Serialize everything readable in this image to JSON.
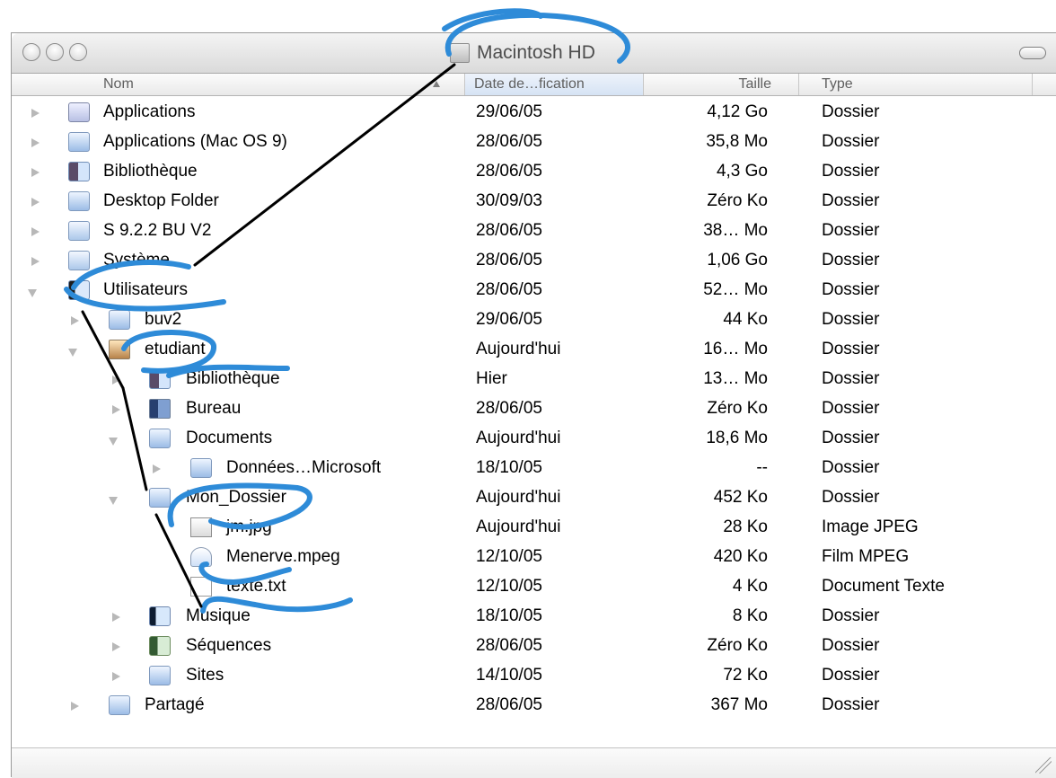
{
  "window": {
    "title": "Macintosh HD",
    "colors": {
      "annotation_blue": "#2e8bd8",
      "annotation_black": "#000000"
    }
  },
  "columns": {
    "name": "Nom",
    "date": "Date de…fication",
    "size": "Taille",
    "type": "Type"
  },
  "rows": [
    {
      "name": "Applications",
      "date": "29/06/05",
      "size": "4,12 Go",
      "type": "Dossier",
      "icon": "applications-folder-icon",
      "disclosure": "collapsed"
    },
    {
      "name": "Applications (Mac OS 9)",
      "date": "28/06/05",
      "size": "35,8 Mo",
      "type": "Dossier",
      "icon": "folder-icon",
      "disclosure": "collapsed"
    },
    {
      "name": "Bibliothèque",
      "date": "28/06/05",
      "size": "4,3 Go",
      "type": "Dossier",
      "icon": "library-folder-icon",
      "disclosure": "collapsed"
    },
    {
      "name": "Desktop Folder",
      "date": "30/09/03",
      "size": "Zéro Ko",
      "type": "Dossier",
      "icon": "folder-icon",
      "disclosure": "collapsed"
    },
    {
      "name": "S 9.2.2 BU V2",
      "date": "28/06/05",
      "size": "38… Mo",
      "type": "Dossier",
      "icon": "system-folder-icon",
      "disclosure": "collapsed"
    },
    {
      "name": "Système",
      "date": "28/06/05",
      "size": "1,06 Go",
      "type": "Dossier",
      "icon": "system-folder-icon",
      "disclosure": "collapsed"
    },
    {
      "name": "Utilisateurs",
      "date": "28/06/05",
      "size": "52… Mo",
      "type": "Dossier",
      "icon": "users-folder-icon",
      "disclosure": "expanded"
    },
    {
      "name": "buv2",
      "date": "29/06/05",
      "size": "44 Ko",
      "type": "Dossier",
      "icon": "folder-icon",
      "disclosure": "collapsed"
    },
    {
      "name": "etudiant",
      "date": "Aujourd'hui",
      "size": "16… Mo",
      "type": "Dossier",
      "icon": "home-folder-icon",
      "disclosure": "expanded"
    },
    {
      "name": "Bibliothèque",
      "date": "Hier",
      "size": "13… Mo",
      "type": "Dossier",
      "icon": "library-folder-icon",
      "disclosure": "collapsed"
    },
    {
      "name": "Bureau",
      "date": "28/06/05",
      "size": "Zéro Ko",
      "type": "Dossier",
      "icon": "desktop-folder-icon",
      "disclosure": "collapsed"
    },
    {
      "name": "Documents",
      "date": "Aujourd'hui",
      "size": "18,6 Mo",
      "type": "Dossier",
      "icon": "documents-folder-icon",
      "disclosure": "expanded"
    },
    {
      "name": "Données…Microsoft",
      "date": "18/10/05",
      "size": "--",
      "type": "Dossier",
      "icon": "folder-icon",
      "disclosure": "collapsed"
    },
    {
      "name": "Mon_Dossier",
      "date": "Aujourd'hui",
      "size": "452 Ko",
      "type": "Dossier",
      "icon": "folder-icon",
      "disclosure": "expanded"
    },
    {
      "name": "jm.jpg",
      "date": "Aujourd'hui",
      "size": "28 Ko",
      "type": "Image JPEG",
      "icon": "jpeg-file-icon",
      "disclosure": "none"
    },
    {
      "name": "Menerve.mpeg",
      "date": "12/10/05",
      "size": "420 Ko",
      "type": "Film MPEG",
      "icon": "mpeg-file-icon",
      "disclosure": "none"
    },
    {
      "name": "texte.txt",
      "date": "12/10/05",
      "size": "4 Ko",
      "type": "Document Texte",
      "icon": "text-file-icon",
      "disclosure": "none"
    },
    {
      "name": "Musique",
      "date": "18/10/05",
      "size": "8 Ko",
      "type": "Dossier",
      "icon": "music-folder-icon",
      "disclosure": "collapsed"
    },
    {
      "name": "Séquences",
      "date": "28/06/05",
      "size": "Zéro Ko",
      "type": "Dossier",
      "icon": "movies-folder-icon",
      "disclosure": "collapsed"
    },
    {
      "name": "Sites",
      "date": "14/10/05",
      "size": "72 Ko",
      "type": "Dossier",
      "icon": "sites-folder-icon",
      "disclosure": "collapsed"
    },
    {
      "name": "Partagé",
      "date": "28/06/05",
      "size": "367 Mo",
      "type": "Dossier",
      "icon": "folder-icon",
      "disclosure": "collapsed"
    }
  ]
}
